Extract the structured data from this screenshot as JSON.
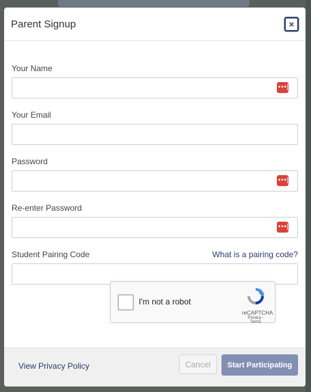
{
  "modal": {
    "title": "Parent Signup",
    "close_label": "×"
  },
  "form": {
    "name_label": "Your Name",
    "email_label": "Your Email",
    "password_label": "Password",
    "reenter_label": "Re-enter Password",
    "pairing_label": "Student Pairing Code",
    "pairing_help": "What is a pairing code?",
    "password_manager_icon": "•••|"
  },
  "captcha": {
    "label": "I'm not a robot",
    "brand": "reCAPTCHA",
    "terms": "Privacy - Terms"
  },
  "footer": {
    "privacy_link": "View Privacy Policy",
    "cancel_label": "Cancel",
    "start_label": "Start Participating"
  },
  "colors": {
    "accent": "#8390b3",
    "pw_icon": "#d9433b",
    "link": "#2b3a6b"
  }
}
